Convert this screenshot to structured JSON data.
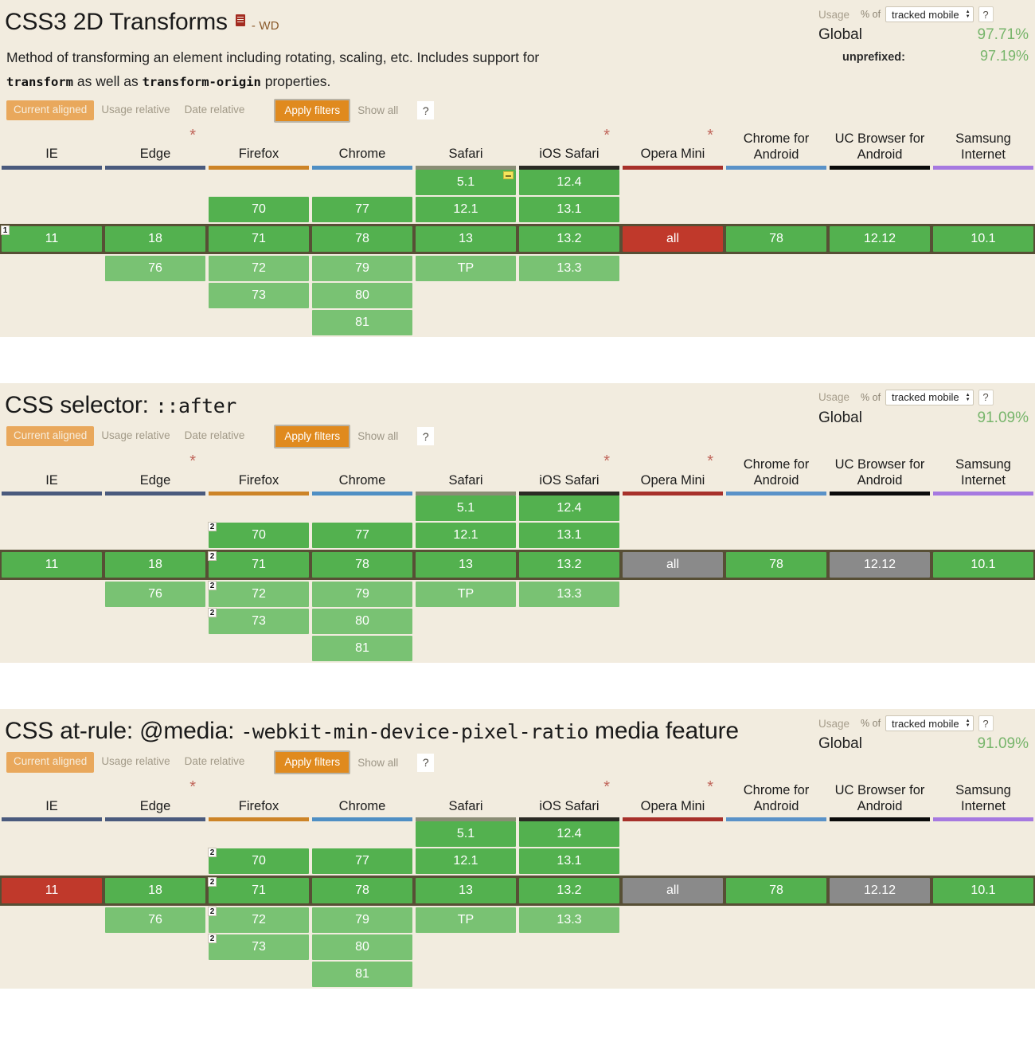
{
  "common": {
    "usage_label": "Usage",
    "pct_of_label": "% of",
    "select_value": "tracked mobile",
    "help_label": "?",
    "global_label": "Global",
    "filters": {
      "current_aligned": "Current aligned",
      "usage_relative": "Usage relative",
      "date_relative": "Date relative",
      "apply_filters": "Apply filters",
      "show_all": "Show all",
      "help": "?"
    },
    "browsers": [
      {
        "name": "IE",
        "star": false,
        "bar_color": "#4a5a7d"
      },
      {
        "name": "Edge",
        "star": true,
        "bar_color": "#4a5a7d"
      },
      {
        "name": "Firefox",
        "star": false,
        "bar_color": "#cd8427"
      },
      {
        "name": "Chrome",
        "star": false,
        "bar_color": "#4f8fc4"
      },
      {
        "name": "Safari",
        "star": false,
        "bar_color": "#8a8d75"
      },
      {
        "name": "iOS Safari",
        "star": true,
        "bar_color": "#2b2b24"
      },
      {
        "name": "Opera Mini",
        "star": true,
        "bar_color": "#a7302a"
      },
      {
        "name": "Chrome for Android",
        "star": false,
        "bar_color": "#5a92c8"
      },
      {
        "name": "UC Browser for Android",
        "star": false,
        "bar_color": "#0b0b0b"
      },
      {
        "name": "Samsung Internet",
        "star": false,
        "bar_color": "#a679e0"
      }
    ],
    "colors": {
      "page_bg": "#f2ecdf",
      "supported": "#53b14f",
      "supported_future": "#79c273",
      "unsupported": "#c0392b",
      "unknown": "#8a8a8a",
      "accent": "#e08a1e",
      "current_band": "#574f35",
      "usage_pct": "#77b56b"
    }
  },
  "sections": [
    {
      "id": "css3-2d-transforms",
      "title": "CSS3 2D Transforms",
      "title_mono": "",
      "title_suffix": "",
      "spec_status": "- WD",
      "has_doc_icon": true,
      "description_pre": "Method of transforming an element including rotating, scaling, etc. Includes support for ",
      "description_code1": "transform",
      "description_mid": " as well as ",
      "description_code2": "transform-origin",
      "description_post": " properties.",
      "usage": {
        "global_label": "Global",
        "global_value": "97.71%",
        "sub_label": "unprefixed:",
        "sub_value": "97.19%"
      },
      "rows": {
        "above": [
          [
            "",
            "",
            "",
            "",
            "5.1",
            "12.4",
            "",
            "",
            "",
            ""
          ],
          [
            "",
            "",
            "70",
            "77",
            "12.1",
            "13.1",
            "",
            "",
            "",
            ""
          ]
        ],
        "above_state": [
          [
            "empty",
            "empty",
            "empty",
            "empty",
            "green",
            "green",
            "empty",
            "empty",
            "empty",
            "empty"
          ],
          [
            "empty",
            "empty",
            "green",
            "green",
            "green",
            "green",
            "empty",
            "empty",
            "empty",
            "empty"
          ]
        ],
        "above_notes": [
          [
            "",
            "",
            "",
            "",
            "",
            "",
            "",
            "",
            "",
            ""
          ],
          [
            "",
            "",
            "",
            "",
            "",
            "",
            "",
            "",
            "",
            ""
          ]
        ],
        "above_badge": [
          [
            "",
            "",
            "",
            "",
            "yellow",
            "",
            "",
            "",
            "",
            ""
          ],
          [
            "",
            "",
            "",
            "",
            "",
            "",
            "",
            "",
            "",
            ""
          ]
        ],
        "current": [
          "11",
          "18",
          "71",
          "78",
          "13",
          "13.2",
          "all",
          "78",
          "12.12",
          "10.1"
        ],
        "current_state": [
          "green",
          "green",
          "green",
          "green",
          "green",
          "green",
          "red",
          "green",
          "green",
          "green"
        ],
        "current_notes": [
          "1",
          "",
          "",
          "",
          "",
          "",
          "",
          "",
          "",
          ""
        ],
        "below": [
          [
            "",
            "76",
            "72",
            "79",
            "TP",
            "13.3",
            "",
            "",
            "",
            ""
          ],
          [
            "",
            "",
            "73",
            "80",
            "",
            "",
            "",
            "",
            "",
            ""
          ],
          [
            "",
            "",
            "",
            "81",
            "",
            "",
            "",
            "",
            "",
            ""
          ]
        ],
        "below_state": [
          [
            "empty",
            "greenlight",
            "greenlight",
            "greenlight",
            "greenlight",
            "greenlight",
            "empty",
            "empty",
            "empty",
            "empty"
          ],
          [
            "empty",
            "empty",
            "greenlight",
            "greenlight",
            "empty",
            "empty",
            "empty",
            "empty",
            "empty",
            "empty"
          ],
          [
            "empty",
            "empty",
            "empty",
            "greenlight",
            "empty",
            "empty",
            "empty",
            "empty",
            "empty",
            "empty"
          ]
        ],
        "below_notes": [
          [
            "",
            "",
            "",
            "",
            "",
            "",
            "",
            "",
            "",
            ""
          ],
          [
            "",
            "",
            "",
            "",
            "",
            "",
            "",
            "",
            "",
            ""
          ],
          [
            "",
            "",
            "",
            "",
            "",
            "",
            "",
            "",
            "",
            ""
          ]
        ]
      }
    },
    {
      "id": "css-selector-after",
      "title": "CSS selector: ",
      "title_mono": "::after",
      "title_suffix": "",
      "spec_status": "",
      "has_doc_icon": false,
      "description_pre": "",
      "description_code1": "",
      "description_mid": "",
      "description_code2": "",
      "description_post": "",
      "usage": {
        "global_label": "Global",
        "global_value": "91.09%",
        "sub_label": "",
        "sub_value": ""
      },
      "rows": {
        "above": [
          [
            "",
            "",
            "",
            "",
            "5.1",
            "12.4",
            "",
            "",
            "",
            ""
          ],
          [
            "",
            "",
            "70",
            "77",
            "12.1",
            "13.1",
            "",
            "",
            "",
            ""
          ]
        ],
        "above_state": [
          [
            "empty",
            "empty",
            "empty",
            "empty",
            "green",
            "green",
            "empty",
            "empty",
            "empty",
            "empty"
          ],
          [
            "empty",
            "empty",
            "green",
            "green",
            "green",
            "green",
            "empty",
            "empty",
            "empty",
            "empty"
          ]
        ],
        "above_notes": [
          [
            "",
            "",
            "",
            "",
            "",
            "",
            "",
            "",
            "",
            ""
          ],
          [
            "",
            "",
            "2",
            "",
            "",
            "",
            "",
            "",
            "",
            ""
          ]
        ],
        "above_badge": [
          [
            "",
            "",
            "",
            "",
            "",
            "",
            "",
            "",
            "",
            ""
          ],
          [
            "",
            "",
            "",
            "",
            "",
            "",
            "",
            "",
            "",
            ""
          ]
        ],
        "current": [
          "11",
          "18",
          "71",
          "78",
          "13",
          "13.2",
          "all",
          "78",
          "12.12",
          "10.1"
        ],
        "current_state": [
          "green",
          "green",
          "green",
          "green",
          "green",
          "green",
          "gray",
          "green",
          "gray",
          "green"
        ],
        "current_notes": [
          "",
          "",
          "2",
          "",
          "",
          "",
          "",
          "",
          "",
          ""
        ],
        "below": [
          [
            "",
            "76",
            "72",
            "79",
            "TP",
            "13.3",
            "",
            "",
            "",
            ""
          ],
          [
            "",
            "",
            "73",
            "80",
            "",
            "",
            "",
            "",
            "",
            ""
          ],
          [
            "",
            "",
            "",
            "81",
            "",
            "",
            "",
            "",
            "",
            ""
          ]
        ],
        "below_state": [
          [
            "empty",
            "greenlight",
            "greenlight",
            "greenlight",
            "greenlight",
            "greenlight",
            "empty",
            "empty",
            "empty",
            "empty"
          ],
          [
            "empty",
            "empty",
            "greenlight",
            "greenlight",
            "empty",
            "empty",
            "empty",
            "empty",
            "empty",
            "empty"
          ],
          [
            "empty",
            "empty",
            "empty",
            "greenlight",
            "empty",
            "empty",
            "empty",
            "empty",
            "empty",
            "empty"
          ]
        ],
        "below_notes": [
          [
            "",
            "",
            "2",
            "",
            "",
            "",
            "",
            "",
            "",
            ""
          ],
          [
            "",
            "",
            "2",
            "",
            "",
            "",
            "",
            "",
            "",
            ""
          ],
          [
            "",
            "",
            "",
            "",
            "",
            "",
            "",
            "",
            "",
            ""
          ]
        ]
      }
    },
    {
      "id": "css-at-rule-media-dpr",
      "title": "CSS at-rule: @media: ",
      "title_mono": "-webkit-min-device-pixel-ratio",
      "title_suffix": " media feature",
      "spec_status": "",
      "has_doc_icon": false,
      "description_pre": "",
      "description_code1": "",
      "description_mid": "",
      "description_code2": "",
      "description_post": "",
      "usage": {
        "global_label": "Global",
        "global_value": "91.09%",
        "sub_label": "",
        "sub_value": ""
      },
      "rows": {
        "above": [
          [
            "",
            "",
            "",
            "",
            "5.1",
            "12.4",
            "",
            "",
            "",
            ""
          ],
          [
            "",
            "",
            "70",
            "77",
            "12.1",
            "13.1",
            "",
            "",
            "",
            ""
          ]
        ],
        "above_state": [
          [
            "empty",
            "empty",
            "empty",
            "empty",
            "green",
            "green",
            "empty",
            "empty",
            "empty",
            "empty"
          ],
          [
            "empty",
            "empty",
            "green",
            "green",
            "green",
            "green",
            "empty",
            "empty",
            "empty",
            "empty"
          ]
        ],
        "above_notes": [
          [
            "",
            "",
            "",
            "",
            "",
            "",
            "",
            "",
            "",
            ""
          ],
          [
            "",
            "",
            "2",
            "",
            "",
            "",
            "",
            "",
            "",
            ""
          ]
        ],
        "above_badge": [
          [
            "",
            "",
            "",
            "",
            "",
            "",
            "",
            "",
            "",
            ""
          ],
          [
            "",
            "",
            "",
            "",
            "",
            "",
            "",
            "",
            "",
            ""
          ]
        ],
        "current": [
          "11",
          "18",
          "71",
          "78",
          "13",
          "13.2",
          "all",
          "78",
          "12.12",
          "10.1"
        ],
        "current_state": [
          "red",
          "green",
          "green",
          "green",
          "green",
          "green",
          "gray",
          "green",
          "gray",
          "green"
        ],
        "current_notes": [
          "",
          "",
          "2",
          "",
          "",
          "",
          "",
          "",
          "",
          ""
        ],
        "below": [
          [
            "",
            "76",
            "72",
            "79",
            "TP",
            "13.3",
            "",
            "",
            "",
            ""
          ],
          [
            "",
            "",
            "73",
            "80",
            "",
            "",
            "",
            "",
            "",
            ""
          ],
          [
            "",
            "",
            "",
            "81",
            "",
            "",
            "",
            "",
            "",
            ""
          ]
        ],
        "below_state": [
          [
            "empty",
            "greenlight",
            "greenlight",
            "greenlight",
            "greenlight",
            "greenlight",
            "empty",
            "empty",
            "empty",
            "empty"
          ],
          [
            "empty",
            "empty",
            "greenlight",
            "greenlight",
            "empty",
            "empty",
            "empty",
            "empty",
            "empty",
            "empty"
          ],
          [
            "empty",
            "empty",
            "empty",
            "greenlight",
            "empty",
            "empty",
            "empty",
            "empty",
            "empty",
            "empty"
          ]
        ],
        "below_notes": [
          [
            "",
            "",
            "2",
            "",
            "",
            "",
            "",
            "",
            "",
            ""
          ],
          [
            "",
            "",
            "2",
            "",
            "",
            "",
            "",
            "",
            "",
            ""
          ],
          [
            "",
            "",
            "",
            "",
            "",
            "",
            "",
            "",
            "",
            ""
          ]
        ]
      }
    }
  ]
}
